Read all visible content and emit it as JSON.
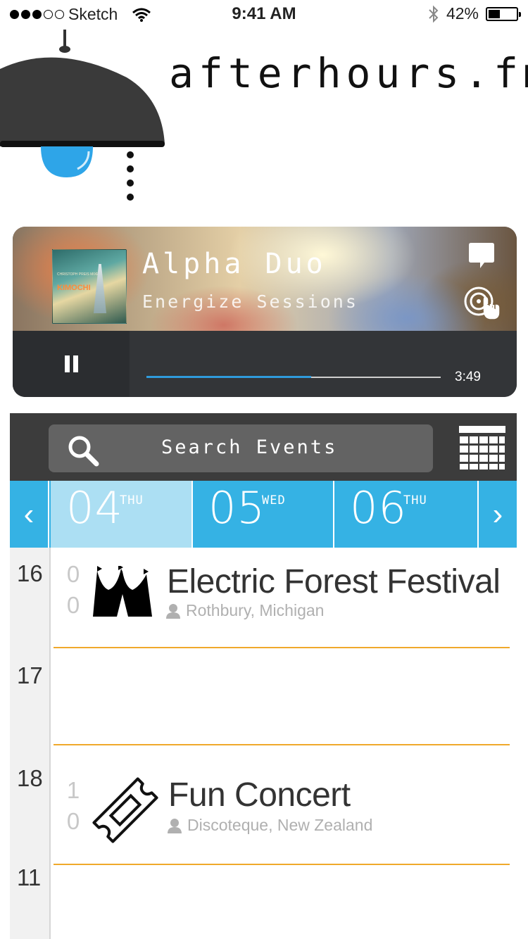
{
  "status_bar": {
    "carrier": "Sketch",
    "time": "9:41 AM",
    "battery_percent": "42%",
    "signal_bars_filled": 3,
    "signal_bars_total": 5,
    "battery_level": 0.42
  },
  "brand": {
    "title": "afterhours.fm",
    "bulb_color": "#2ea5e8"
  },
  "player": {
    "artist": "Alpha Duo",
    "show": "Energize Sessions",
    "cover_text": "KIMOCHI",
    "duration": "3:49",
    "progress": 0.56,
    "state": "playing",
    "icons": [
      "pause-icon",
      "chat-icon",
      "dj-request-icon"
    ]
  },
  "search": {
    "placeholder": "Search Events",
    "calendar_icon": "calendar-grid-icon"
  },
  "dates": {
    "prev": "‹",
    "next": "›",
    "days": [
      {
        "num": "04",
        "dow": "THU",
        "selected": true
      },
      {
        "num": "05",
        "dow": "WED",
        "selected": false
      },
      {
        "num": "06",
        "dow": "THU",
        "selected": false
      }
    ],
    "accent": "#35b2e4",
    "selected_color": "#acdff3"
  },
  "timeline": {
    "hours": [
      "16",
      "17",
      "18",
      "11"
    ],
    "divider_color": "#f0a92b",
    "events": [
      {
        "hour": "16",
        "minutes": [
          "0",
          "0"
        ],
        "title": "Electric Forest Festival",
        "location": "Rothbury, Michigan",
        "icon": "circus-tent-icon"
      },
      {
        "hour": "18",
        "minutes": [
          "1",
          "0"
        ],
        "title": "Fun Concert",
        "location": "Discoteque, New Zealand",
        "icon": "ticket-icon"
      }
    ]
  }
}
